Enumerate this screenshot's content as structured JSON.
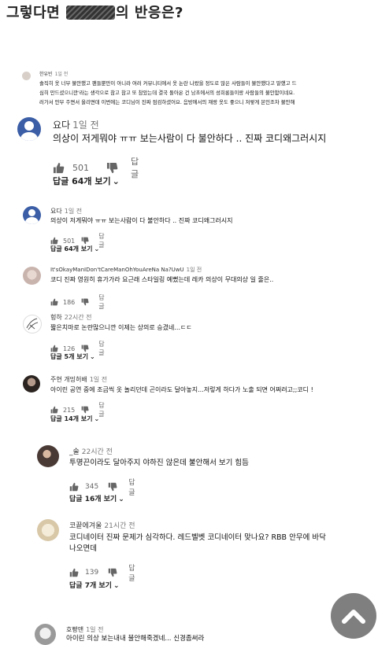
{
  "title": {
    "before": "그렇다면 ",
    "after": "의 반응은?"
  },
  "comments": [
    {
      "name": "한유빈",
      "time": "1일 전",
      "lines": [
        "솔직히 옷 너무 불안했고 팬들뿐만이 아니라 여러 커뮤니티에서 옷 논란 나왔을 정도로 많은 사람들이 불안했다고 말했고 드",
        "심히 만드셨으니깐'라는 생각으로 참고 참고 또 참았는데 결국 돌아온 건 남초에서의 성희롱들이랑 사람들의 불안함이네요.",
        "러가서 안무 주면서 올리면데 이번에는 코디님이 진짜 점검하셨어요. 음방에서의 재랑 옷도 좋으니 저렇게 본인조차 불안해"
      ]
    },
    {
      "name": "요다",
      "time": "1일 전",
      "text": "의상이 저게뭐야 ㅠㅠ 보는사람이 다 불안하다 .. 진짜 코디왜그러시지",
      "likes": "501",
      "reply": "답글",
      "more": "답글 64개 보기"
    },
    {
      "name": "요다",
      "time": "1일 전",
      "text": "의상이 저게뭐야 ㅠㅠ 보는사람이 다 불안하다 .. 진짜 코디왜그러시지",
      "likes": "501",
      "reply": "답글",
      "more": "답글 64개 보기"
    },
    {
      "name": "It'sOkayManIDon'tCareManOhYouAreNa Na?UwU",
      "time": "1일 전",
      "text": "코디 진짜 영원히 휴가가라 요근래 스타일링 예뻤는데 레카 의상이 무대의상 일 줄은..",
      "likes": "186",
      "reply": "답글"
    },
    {
      "name": "헝하",
      "time": "22시간 전",
      "text": "짧은치마로 논란많으니깐 이제는 상의로 승겼네...ㄷㄷ",
      "likes": "126",
      "reply": "답글",
      "more": "답글 5개 보기"
    },
    {
      "name": "주현 개밍허배",
      "time": "1일 전",
      "text": "아이린 공연 중에 조금씩 옷 놀리던데 곤이라도 달아놓지...저렇게 하다가 노출 되면 어쩌려고;;코디 !",
      "likes": "215",
      "reply": "답글",
      "more": "답글 14개 보기"
    },
    {
      "name": "_술",
      "time": "22시간 전",
      "text": "투명끈이라도 달아주지 야하진 않은데 불안해서 보기 힘듬",
      "likes": "345",
      "reply": "답글",
      "more": "답글 16개 보기"
    },
    {
      "name": "코끝에겨울",
      "time": "21시간 전",
      "lines": [
        "코디네이터 진짜 문제가 심각하다. 레드벨벳 코디네이터 맞나요? RBB 안무에 바닥",
        "나오면데"
      ],
      "likes": "139",
      "reply": "답글",
      "more": "답글 7개 보기"
    },
    {
      "name": "호빵맨",
      "time": "1일 전",
      "text": "아이린 의상 보는내내 불안해죽겠네... 신경좀써라"
    }
  ]
}
